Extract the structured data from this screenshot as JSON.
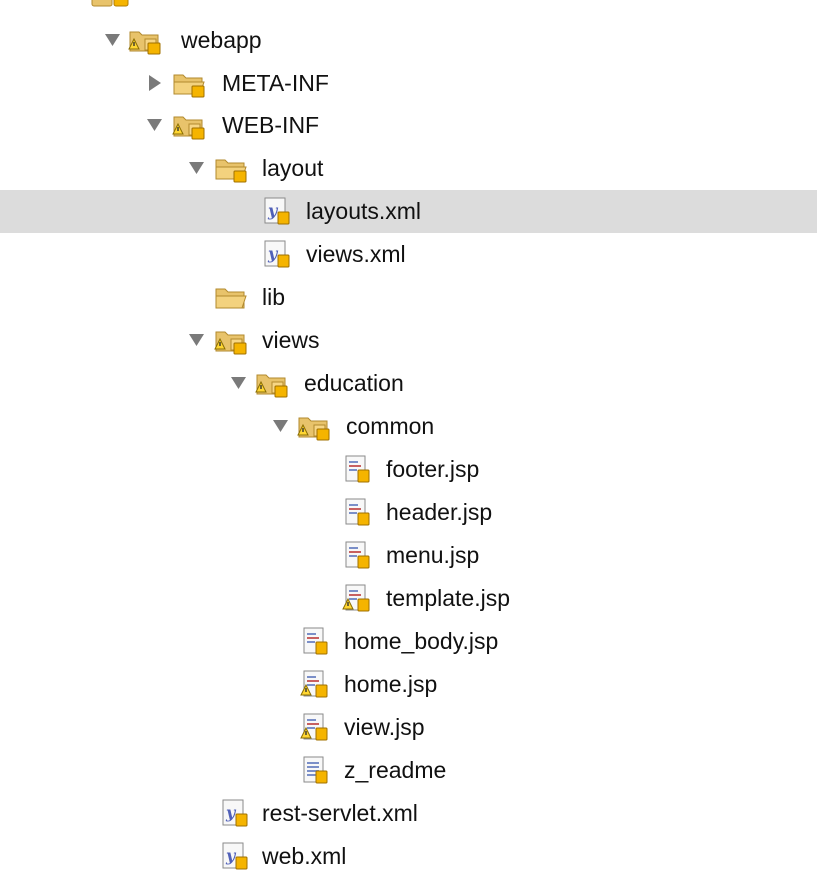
{
  "tree": {
    "items": [
      {
        "label": "webapp",
        "icon": "package-folder-warning-icon",
        "expanded": true
      },
      {
        "label": "META-INF",
        "icon": "folder-warning-icon",
        "expanded": false
      },
      {
        "label": "WEB-INF",
        "icon": "package-folder-warning-icon",
        "expanded": true
      },
      {
        "label": "layout",
        "icon": "folder-open-icon",
        "expanded": true
      },
      {
        "label": "layouts.xml",
        "icon": "xml-file-icon",
        "selected": true
      },
      {
        "label": "views.xml",
        "icon": "xml-file-icon"
      },
      {
        "label": "lib",
        "icon": "folder-icon"
      },
      {
        "label": "views",
        "icon": "package-folder-warning-icon",
        "expanded": true
      },
      {
        "label": "education",
        "icon": "package-folder-warning-icon",
        "expanded": true
      },
      {
        "label": "common",
        "icon": "package-folder-warning-icon",
        "expanded": true
      },
      {
        "label": "footer.jsp",
        "icon": "jsp-file-icon"
      },
      {
        "label": "header.jsp",
        "icon": "jsp-file-icon"
      },
      {
        "label": "menu.jsp",
        "icon": "jsp-file-icon"
      },
      {
        "label": "template.jsp",
        "icon": "jsp-file-warning-icon"
      },
      {
        "label": "home_body.jsp",
        "icon": "jsp-file-icon"
      },
      {
        "label": "home.jsp",
        "icon": "jsp-file-warning-icon"
      },
      {
        "label": "view.jsp",
        "icon": "jsp-file-warning-icon"
      },
      {
        "label": "z_readme",
        "icon": "text-file-icon"
      },
      {
        "label": "rest-servlet.xml",
        "icon": "xml-file-icon"
      },
      {
        "label": "web.xml",
        "icon": "xml-file-icon"
      }
    ]
  },
  "colors": {
    "selection": "#dcdcdc",
    "folder": "#e8c36b",
    "warning": "#f5b400",
    "xml_badge": "#5060b8",
    "arrow": "#7a7a7a"
  }
}
